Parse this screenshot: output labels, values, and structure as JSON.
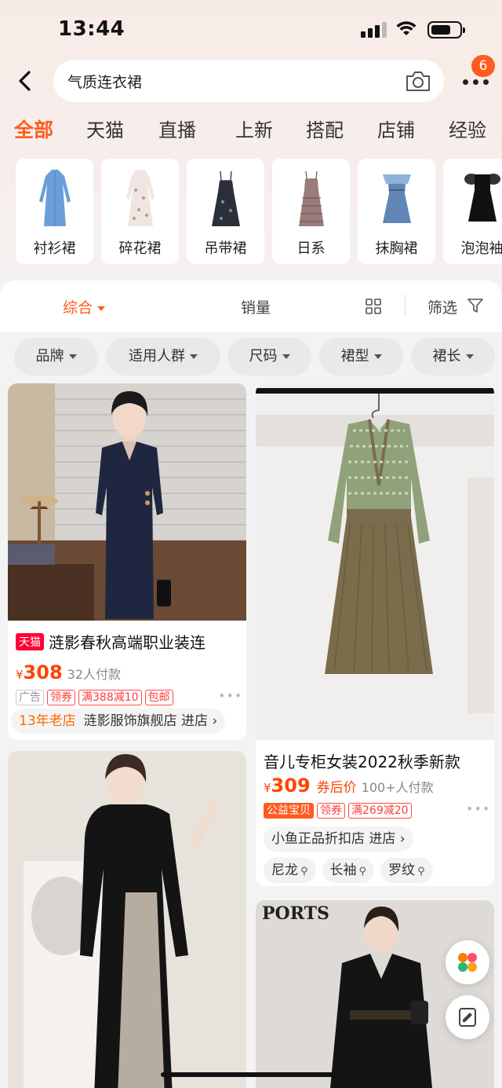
{
  "status": {
    "time": "13:44"
  },
  "search": {
    "query": "气质连衣裙",
    "badge_count": "6"
  },
  "tabs": [
    "全部",
    "天猫",
    "直播",
    "上新",
    "搭配",
    "店铺",
    "经验"
  ],
  "categories": [
    "衬衫裙",
    "碎花裙",
    "吊带裙",
    "日系",
    "抹胸裙",
    "泡泡袖"
  ],
  "sort": {
    "comprehensive": "综合",
    "sales": "销量",
    "filter": "筛选"
  },
  "chips": [
    "品牌",
    "适用人群",
    "尺码",
    "裙型",
    "裙长"
  ],
  "products": [
    {
      "title": "涟影春秋高端职业装连",
      "tmall_tag": "天猫",
      "yen": "¥",
      "price": "308",
      "sold": "32人付款",
      "tags": [
        "广告",
        "领券",
        "满388减10",
        "包邮"
      ],
      "shop_age": "13年老店",
      "shop": "涟影服饰旗舰店 进店",
      "more": "•••"
    },
    {
      "title": "音儿专柜女装2022秋季新款",
      "yen": "¥",
      "price": "309",
      "coupon_after": "券后价",
      "sold": "100+人付款",
      "tags": [
        "公益宝贝",
        "领券",
        "满269减20"
      ],
      "shop": "小鱼正品折扣店 进店",
      "keywords": [
        "尼龙",
        "长袖",
        "罗纹"
      ],
      "more": "•••"
    }
  ],
  "third_card": {
    "brand_text": "PORTS"
  },
  "colors": {
    "accent": "#ff5a1f",
    "price": "#ff4400",
    "tmall": "#ff0036"
  }
}
